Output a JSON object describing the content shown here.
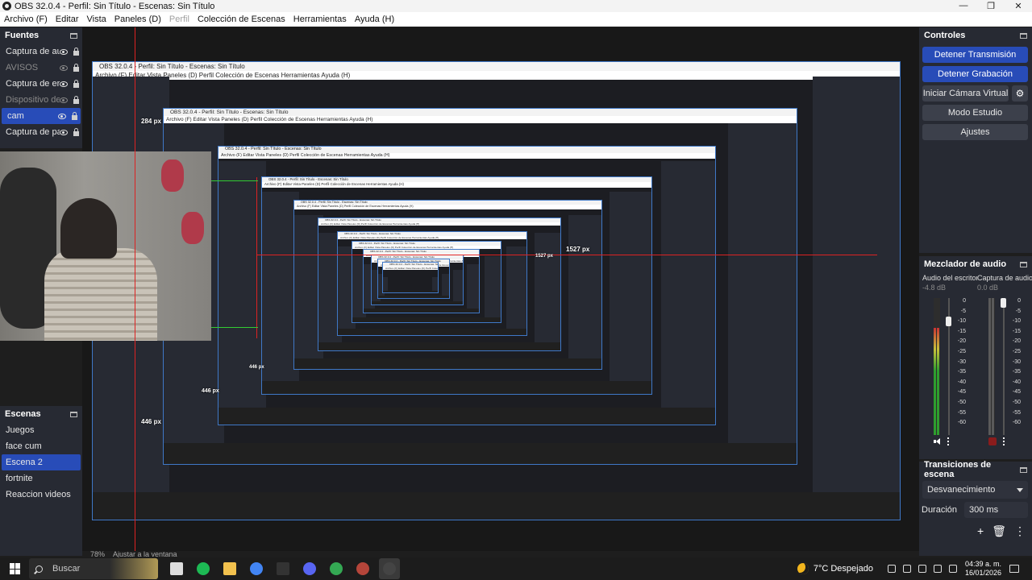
{
  "window": {
    "title": "OBS 32.0.4 - Perfil: Sin Título - Escenas: Sin Título",
    "controls": [
      "—",
      "❐",
      "✕"
    ]
  },
  "menu": [
    {
      "label": "Archivo (F)",
      "enabled": true
    },
    {
      "label": "Editar",
      "enabled": true
    },
    {
      "label": "Vista",
      "enabled": true
    },
    {
      "label": "Paneles (D)",
      "enabled": true
    },
    {
      "label": "Perfil",
      "enabled": false
    },
    {
      "label": "Colección de Escenas",
      "enabled": true
    },
    {
      "label": "Herramientas",
      "enabled": true
    },
    {
      "label": "Ayuda (H)",
      "enabled": true
    }
  ],
  "sources": {
    "title": "Fuentes",
    "items": [
      {
        "label": "Captura de au",
        "visible": true,
        "selected": false
      },
      {
        "label": "AVISOS",
        "visible": false,
        "selected": false
      },
      {
        "label": "Captura de er",
        "visible": true,
        "selected": false
      },
      {
        "label": "Dispositivo de",
        "visible": false,
        "selected": false
      },
      {
        "label": "cam",
        "visible": true,
        "selected": true
      },
      {
        "label": "Captura de pa",
        "visible": true,
        "selected": false
      }
    ]
  },
  "scenes": {
    "title": "Escenas",
    "items": [
      {
        "label": "Juegos",
        "selected": false
      },
      {
        "label": "face cum",
        "selected": false
      },
      {
        "label": "Escena 2",
        "selected": true
      },
      {
        "label": "fortnite",
        "selected": false
      },
      {
        "label": "Reaccion videos",
        "selected": false
      }
    ]
  },
  "controls": {
    "title": "Controles",
    "stop_stream": "Detener Transmisión",
    "stop_recording": "Detener Grabación",
    "start_virtual_cam": "Iniciar Cámara Virtual",
    "studio_mode": "Modo Estudio",
    "settings": "Ajustes"
  },
  "mixer": {
    "title": "Mezclador de audio",
    "ticks": [
      "0",
      "-5",
      "-10",
      "-15",
      "-20",
      "-25",
      "-30",
      "-35",
      "-40",
      "-45",
      "-50",
      "-55",
      "-60"
    ],
    "channels": [
      {
        "name": "Audio del escritorio",
        "db": "-4.8 dB",
        "level": 0.78,
        "muted": false,
        "fader": 0.86
      },
      {
        "name": "Captura de audio",
        "db": "0.0 dB",
        "level": 0.0,
        "muted": true,
        "fader": 1.0
      }
    ]
  },
  "transitions": {
    "title": "Transiciones de escena",
    "selected": "Desvanecimiento",
    "duration_label": "Duración",
    "duration_value": "300 ms"
  },
  "preview": {
    "zoom": "78%",
    "fit_label": "Ajustar a la ventana",
    "px_labels": [
      "284 px",
      "1527 px",
      "1527 px",
      "446 px",
      "446 px",
      "446 px"
    ]
  },
  "taskbar": {
    "search_placeholder": "Buscar",
    "weather": "7°C  Despejado",
    "time": "04:39 a. m.",
    "date": "16/01/2026",
    "apps": [
      {
        "name": "task-view",
        "color": "#dddddd"
      },
      {
        "name": "spotify",
        "color": "#1db954"
      },
      {
        "name": "file-explorer",
        "color": "#f2c14e"
      },
      {
        "name": "chrome",
        "color": "#4285f4"
      },
      {
        "name": "epic-games",
        "color": "#333333"
      },
      {
        "name": "discord",
        "color": "#5865f2"
      },
      {
        "name": "chrome-profile",
        "color": "#34a853"
      },
      {
        "name": "winrar",
        "color": "#b5453a"
      },
      {
        "name": "obs",
        "color": "#444444"
      }
    ]
  },
  "nested_title": "OBS 32.0.4 - Perfil: Sin Título - Escenas: Sin Título",
  "nested_menu": "Archivo (F)   Editar   Vista   Paneles (D)   Perfil   Colección de Escenas   Herramientas   Ayuda (H)"
}
